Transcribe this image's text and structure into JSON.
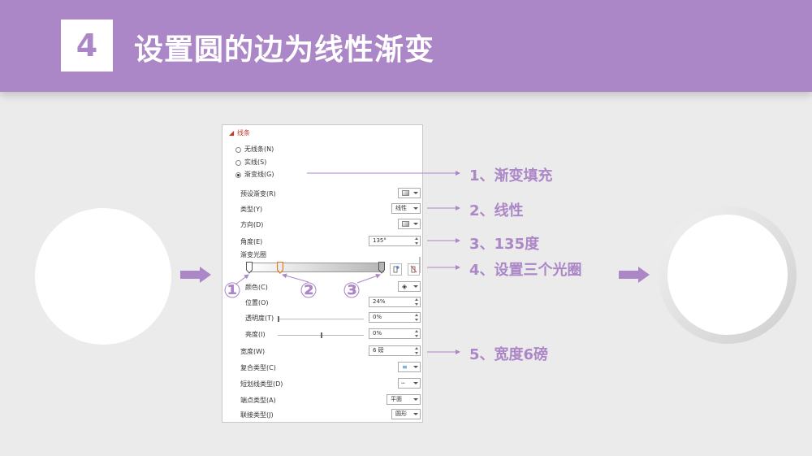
{
  "header": {
    "step": "4",
    "title": "设置圆的边为线性渐变"
  },
  "panel": {
    "section": "线条",
    "options": [
      {
        "label": "无线条(N)",
        "selected": false
      },
      {
        "label": "实线(S)",
        "selected": false
      },
      {
        "label": "渐变线(G)",
        "selected": true
      }
    ],
    "preset_label": "预设渐变(R)",
    "type_label": "类型(Y)",
    "type_value": "线性",
    "direction_label": "方向(D)",
    "angle_label": "角度(E)",
    "angle_value": "135°",
    "stops_label": "渐变光圈",
    "color_label": "颜色(C)",
    "position_label": "位置(O)",
    "position_value": "24%",
    "transparency_label": "透明度(T)",
    "transparency_value": "0%",
    "brightness_label": "亮度(I)",
    "brightness_value": "0%",
    "width_label": "宽度(W)",
    "width_value": "6 磅",
    "compound_label": "复合类型(C)",
    "dash_label": "短划线类型(D)",
    "cap_label": "端点类型(A)",
    "cap_value": "平面",
    "join_label": "联接类型(J)",
    "join_value": "圆形"
  },
  "stop_markers": [
    "①",
    "②",
    "③"
  ],
  "callouts": {
    "c1": "1、渐变填充",
    "c2": "2、线性",
    "c3": "3、135度",
    "c4": "4、设置三个光圈",
    "c5": "5、宽度6磅"
  },
  "colors": {
    "accent": "#ac87c7",
    "background": "#ebebeb",
    "header": "#ac87c7"
  },
  "gradient": {
    "angle_deg": 135,
    "stop_positions_pct": [
      0,
      24,
      100
    ]
  }
}
